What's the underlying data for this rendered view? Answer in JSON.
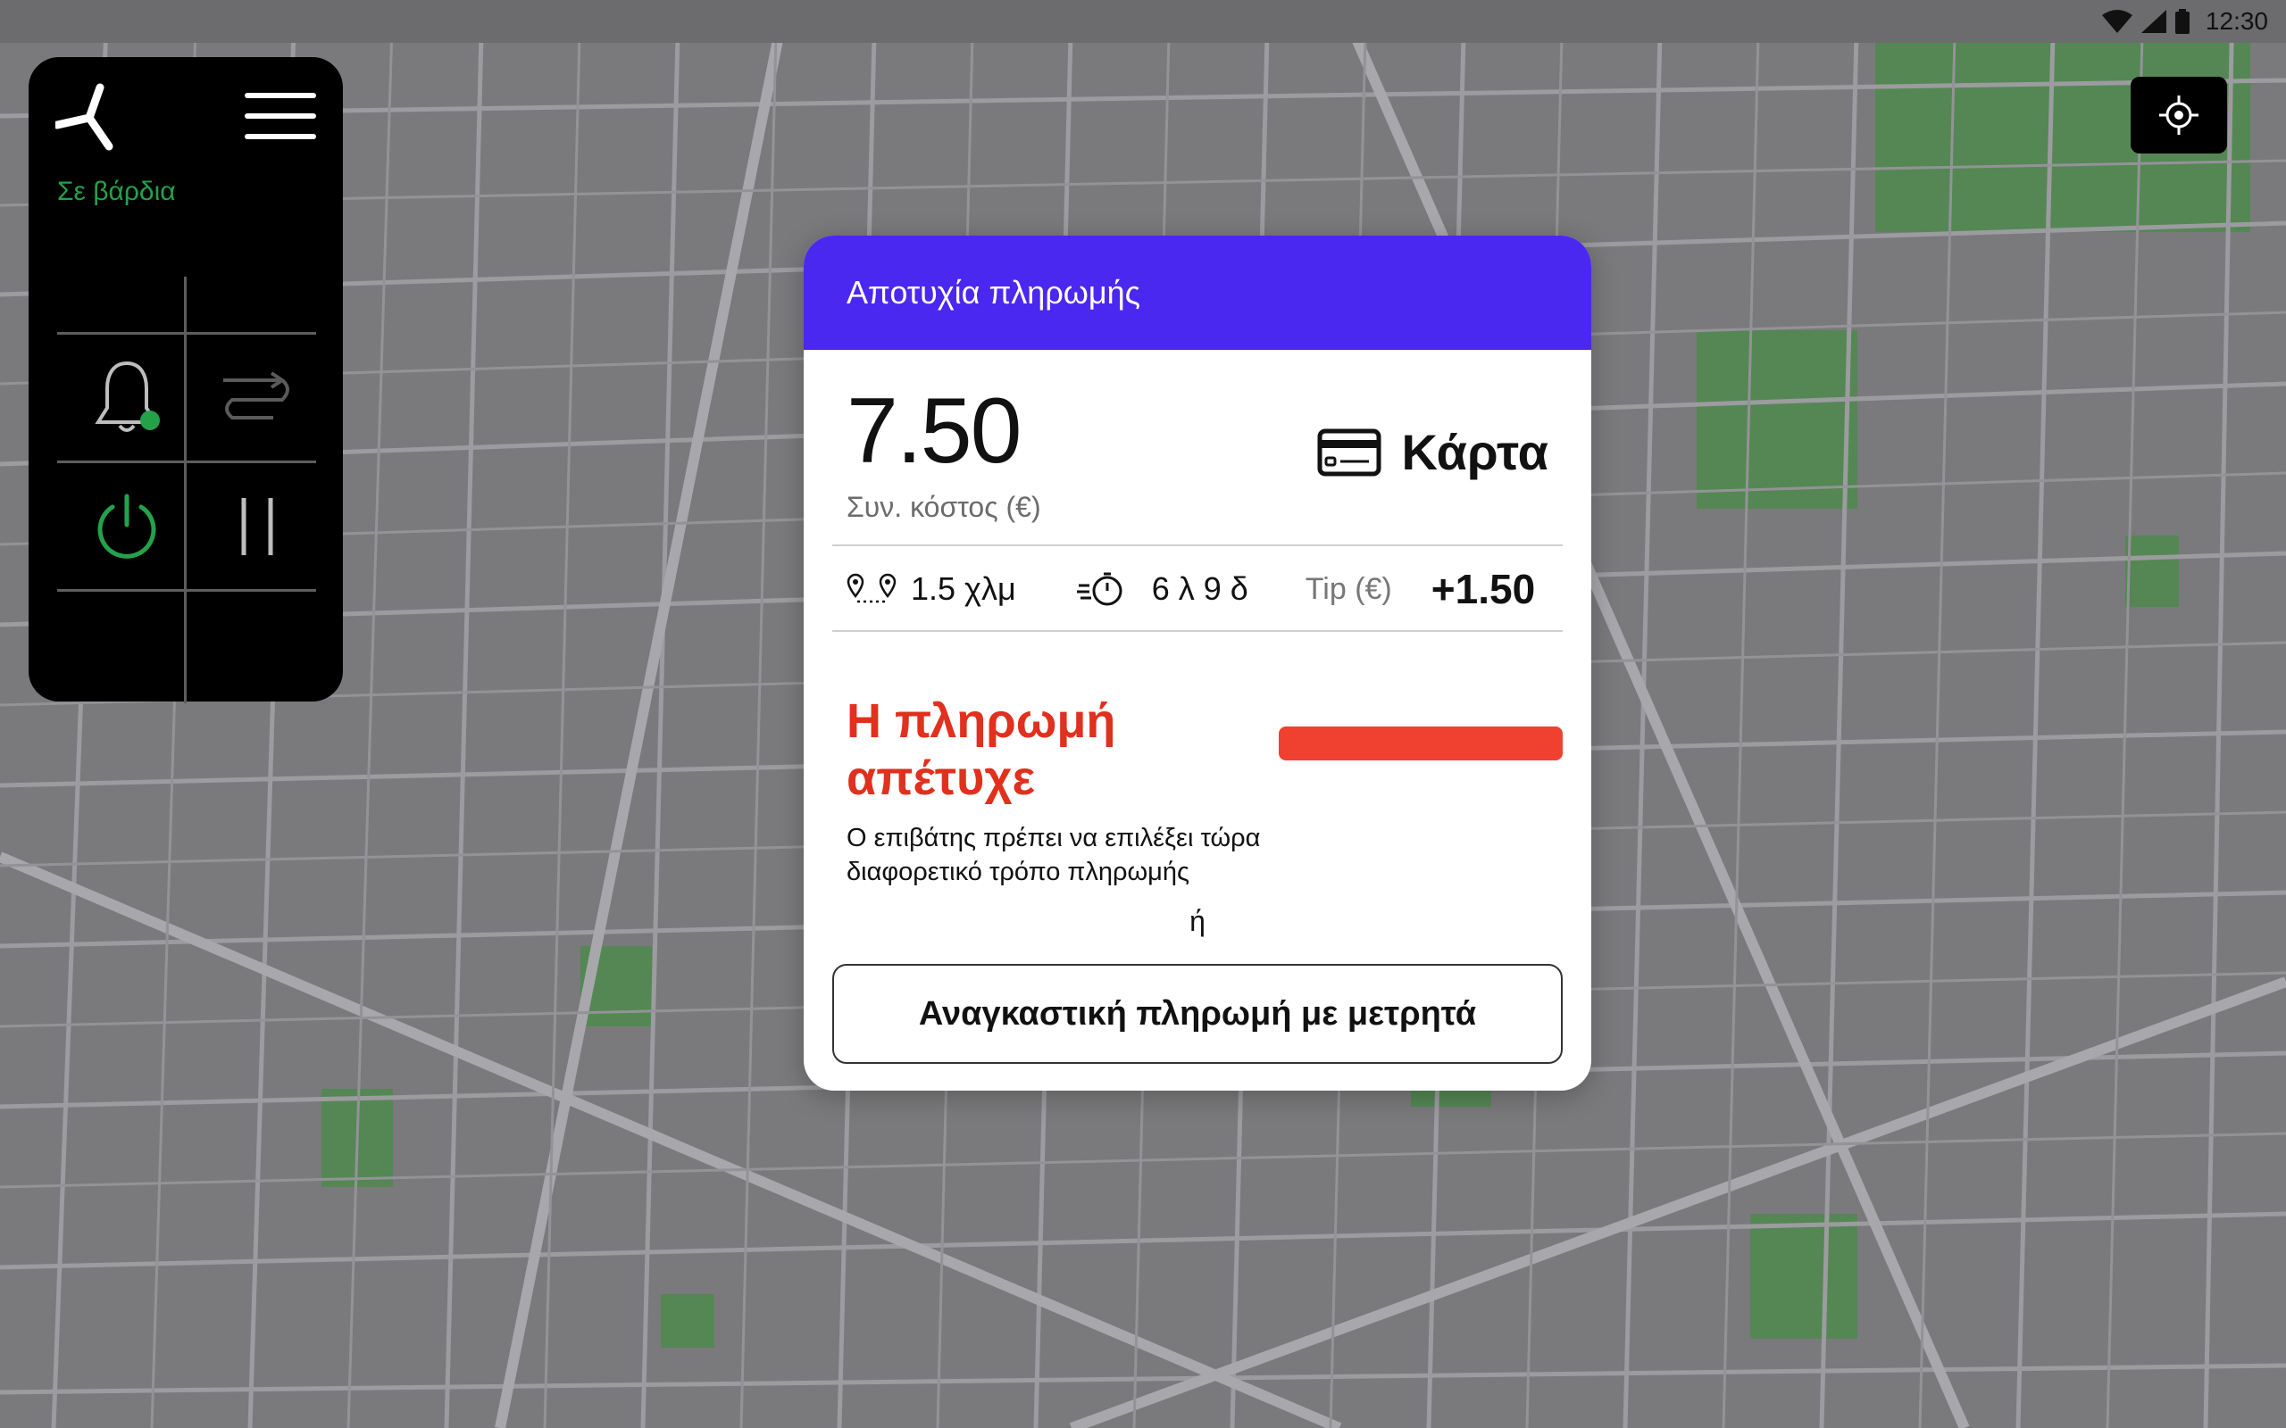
{
  "status_bar": {
    "time": "12:30"
  },
  "sidebar": {
    "shift_status": "Σε βάρδια",
    "shift_color": "#24a24a",
    "icons": [
      "logo-icon",
      "menu-icon",
      "bell-icon",
      "route-icon",
      "power-icon",
      "pause-icon"
    ]
  },
  "dialog": {
    "title": "Αποτυχία πληρωμής",
    "header_color": "#4a28f0",
    "fare_amount": "7.50",
    "fare_label": "Συν. κόστος (€)",
    "payment_method": "Κάρτα",
    "distance": "1.5 χλμ",
    "duration": "6 λ 9 δ",
    "tip_label": "Tip (€)",
    "tip_value": "+1.50",
    "fail_title": "Η πληρωμή απέτυχε",
    "fail_color": "#e0301e",
    "fail_description": "Ο επιβάτης πρέπει να επιλέξει τώρα διαφορετικό τρόπο πληρωμής",
    "or_text": "ή",
    "cash_button_label": "Αναγκαστική πληρωμή με μετρητά"
  }
}
